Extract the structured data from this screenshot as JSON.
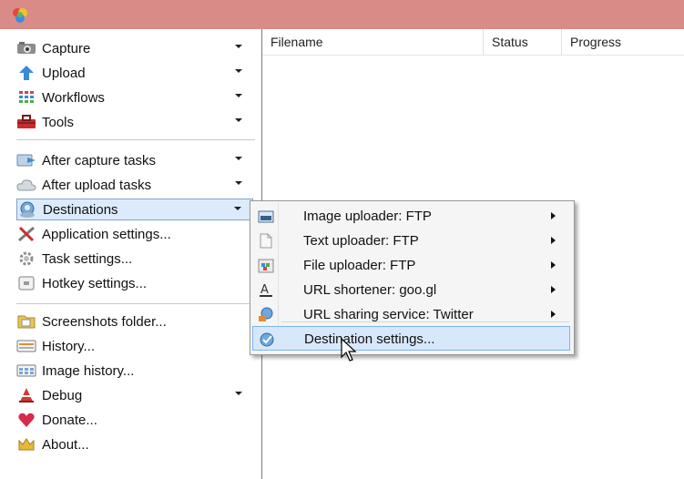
{
  "app": {
    "icon": "sharex-logo-icon"
  },
  "sidebar": {
    "groups": [
      {
        "items": [
          {
            "label": "Capture",
            "icon": "camera-icon",
            "has_dropdown": true
          },
          {
            "label": "Upload",
            "icon": "upload-arrow-icon",
            "has_dropdown": true
          },
          {
            "label": "Workflows",
            "icon": "workflows-grid-icon",
            "has_dropdown": true
          },
          {
            "label": "Tools",
            "icon": "toolbox-icon",
            "has_dropdown": true
          }
        ]
      },
      {
        "items": [
          {
            "label": "After capture tasks",
            "icon": "after-capture-icon",
            "has_dropdown": true
          },
          {
            "label": "After upload tasks",
            "icon": "cloud-icon",
            "has_dropdown": true
          },
          {
            "label": "Destinations",
            "icon": "globe-user-icon",
            "has_dropdown": true,
            "selected": true
          },
          {
            "label": "Application settings...",
            "icon": "tools-icon",
            "has_dropdown": false
          },
          {
            "label": "Task settings...",
            "icon": "gear-icon",
            "has_dropdown": false
          },
          {
            "label": "Hotkey settings...",
            "icon": "keyboard-icon",
            "has_dropdown": false
          }
        ]
      },
      {
        "items": [
          {
            "label": "Screenshots folder...",
            "icon": "folder-icon",
            "has_dropdown": false
          },
          {
            "label": "History...",
            "icon": "history-icon",
            "has_dropdown": false
          },
          {
            "label": "Image history...",
            "icon": "image-history-icon",
            "has_dropdown": false
          },
          {
            "label": "Debug",
            "icon": "warning-cone-icon",
            "has_dropdown": true
          },
          {
            "label": "Donate...",
            "icon": "heart-icon",
            "has_dropdown": false
          },
          {
            "label": "About...",
            "icon": "crown-icon",
            "has_dropdown": false
          }
        ]
      }
    ]
  },
  "list": {
    "columns": [
      "Filename",
      "Status",
      "Progress"
    ]
  },
  "destinations_menu": {
    "items": [
      {
        "label": "Image uploader: FTP",
        "icon": "image-uploader-icon",
        "has_submenu": true
      },
      {
        "label": "Text uploader: FTP",
        "icon": "document-icon",
        "has_submenu": true
      },
      {
        "label": "File uploader: FTP",
        "icon": "file-uploader-icon",
        "has_submenu": true
      },
      {
        "label": "URL shortener: goo.gl",
        "icon": "font-a-icon",
        "has_submenu": true
      },
      {
        "label": "URL sharing service: Twitter",
        "icon": "share-icon",
        "has_submenu": true
      }
    ],
    "settings": {
      "label": "Destination settings...",
      "icon": "globe-check-icon",
      "hovered": true
    }
  },
  "colors": {
    "titlebar": "#d98c87",
    "selected_bg": "#dcebfc",
    "hover_bg": "#d7e8fb",
    "menu_bg": "#f5f5f5"
  }
}
